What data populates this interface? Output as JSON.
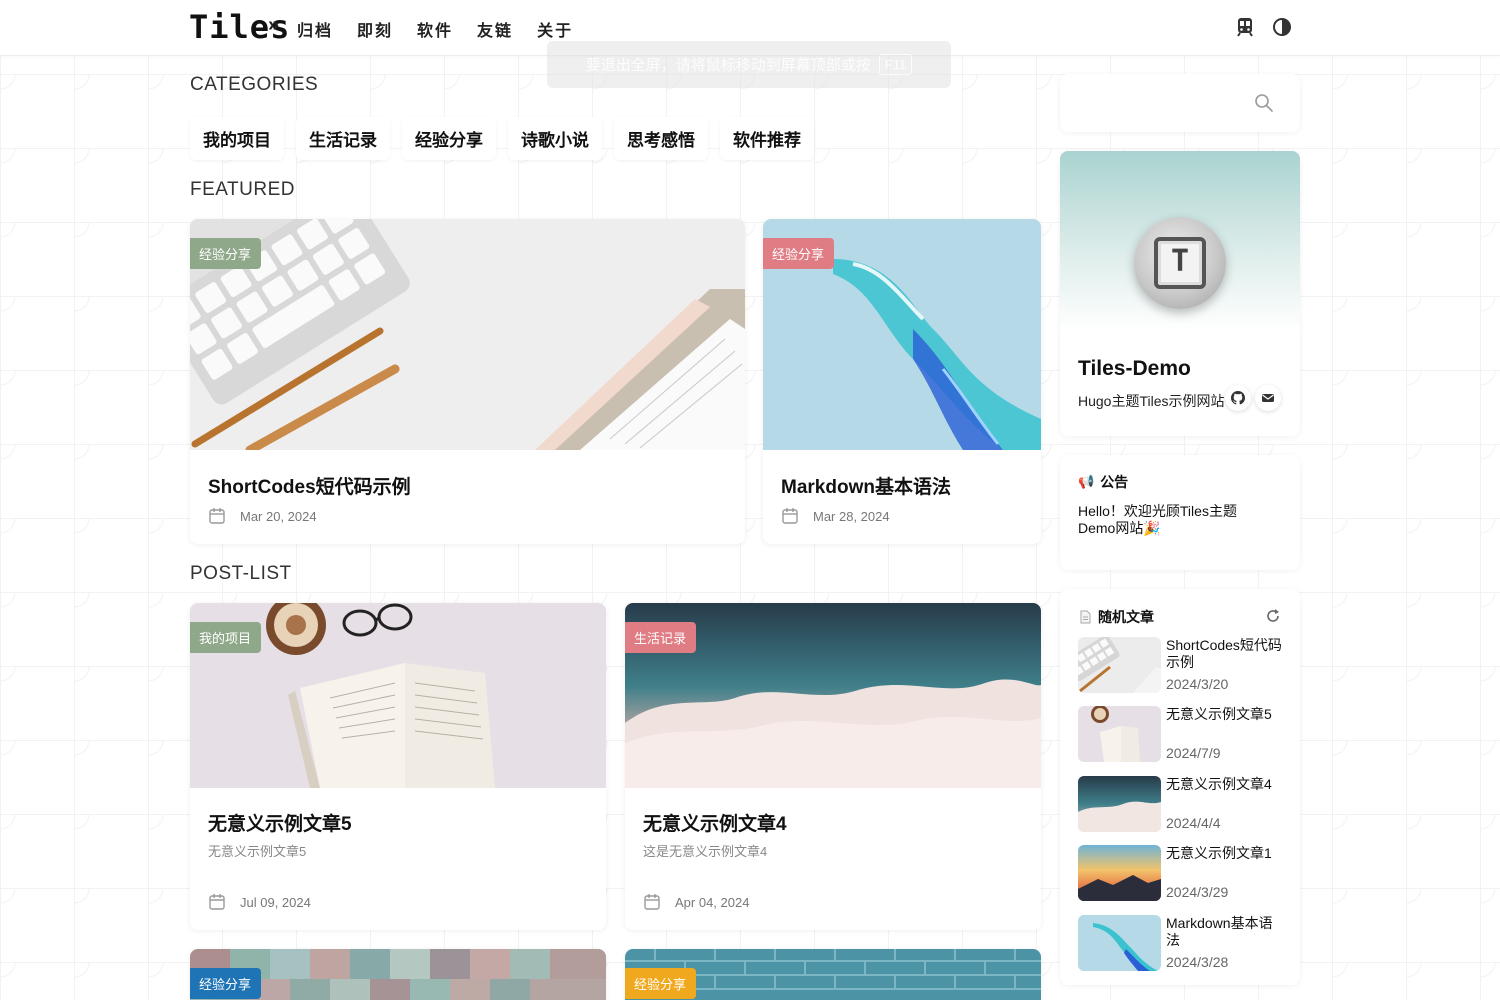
{
  "header": {
    "logo": "Tiles",
    "nav": [
      "归档",
      "即刻",
      "软件",
      "友链",
      "关于"
    ],
    "icons": [
      "train-icon",
      "contrast-icon"
    ]
  },
  "toast": {
    "text": "要退出全屏，请将鼠标移动到屏幕顶部或按",
    "key": "F11"
  },
  "sections": {
    "categories": "CATEGORIES",
    "featured": "FEATURED",
    "postlist": "POST-LIST"
  },
  "categories": [
    "我的项目",
    "生活记录",
    "经验分享",
    "诗歌小说",
    "思考感悟",
    "软件推荐"
  ],
  "featured": [
    {
      "badge": "经验分享",
      "badge_color": "#8fa88a",
      "title": "ShortCodes短代码示例",
      "date": "Mar 20, 2024"
    },
    {
      "badge": "经验分享",
      "badge_color": "#e07c83",
      "title": "Markdown基本语法",
      "date": "Mar 28, 2024"
    }
  ],
  "posts": [
    {
      "badge": "我的项目",
      "badge_color": "#8fa88a",
      "title": "无意义示例文章5",
      "summary": "无意义示例文章5",
      "date": "Jul 09, 2024"
    },
    {
      "badge": "生活记录",
      "badge_color": "#e07c83",
      "title": "无意义示例文章4",
      "summary": "这是无意义示例文章4",
      "date": "Apr 04, 2024"
    },
    {
      "badge": "经验分享",
      "badge_color": "#1f74b5"
    },
    {
      "badge": "经验分享",
      "badge_color": "#f0a81e"
    }
  ],
  "sidebar": {
    "profile": {
      "name": "Tiles-Demo",
      "desc": "Hugo主题Tiles示例网站",
      "avatar_letter": "T"
    },
    "notice": {
      "title": "公告",
      "text": "Hello！欢迎光顾Tiles主题Demo网站🎉"
    },
    "random": {
      "title": "随机文章",
      "items": [
        {
          "title": "ShortCodes短代码示例",
          "date": "2024/3/20"
        },
        {
          "title": "无意义示例文章5",
          "date": "2024/7/9"
        },
        {
          "title": "无意义示例文章4",
          "date": "2024/4/4"
        },
        {
          "title": "无意义示例文章1",
          "date": "2024/3/29"
        },
        {
          "title": "Markdown基本语法",
          "date": "2024/3/28"
        }
      ]
    }
  }
}
